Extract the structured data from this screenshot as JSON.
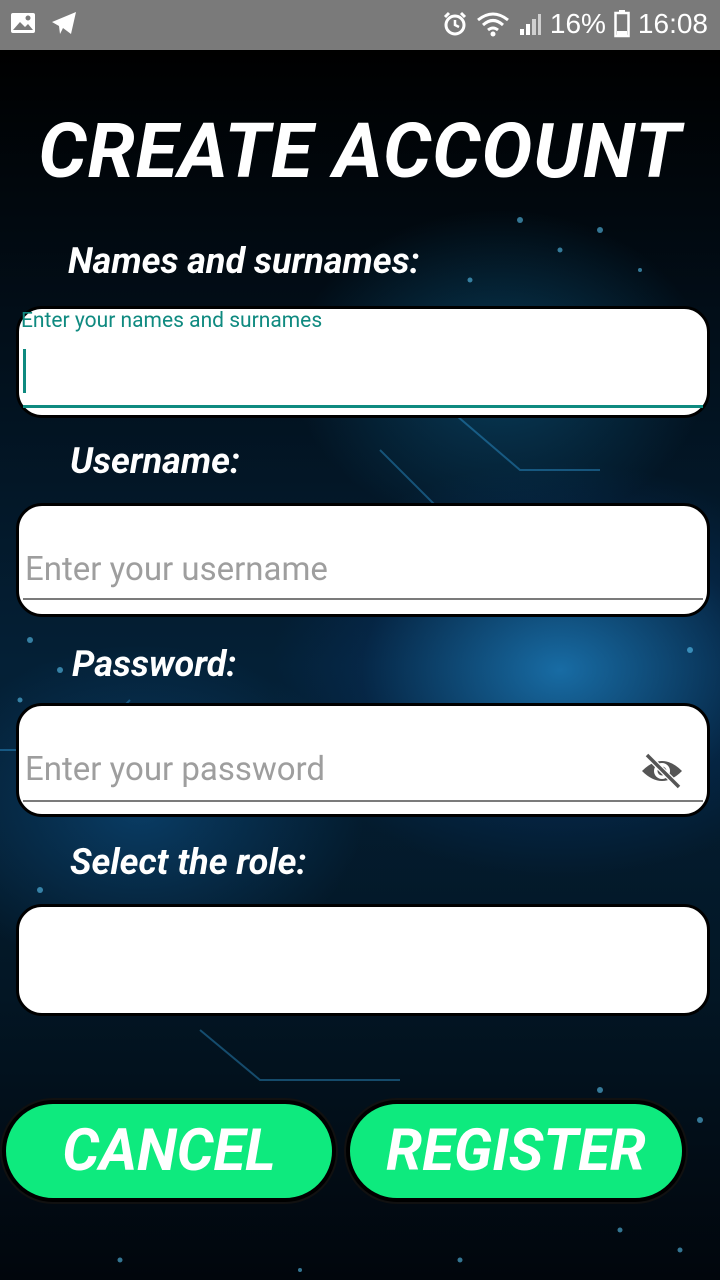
{
  "status_bar": {
    "battery_percent": "16%",
    "time": "16:08",
    "left_icons": [
      "gallery-icon",
      "telegram-icon"
    ],
    "right_icons": [
      "alarm-icon",
      "wifi-icon",
      "signal-icon",
      "battery-icon"
    ]
  },
  "page": {
    "title": "CREATE ACCOUNT"
  },
  "form": {
    "names": {
      "label": "Names and surnames:",
      "floating_hint": "Enter your names and surnames",
      "value": ""
    },
    "username": {
      "label": "Username:",
      "placeholder": "Enter your username"
    },
    "password": {
      "label": "Password:",
      "placeholder": "Enter your password",
      "toggle_icon": "eye-off-icon"
    },
    "role": {
      "label": "Select the role:",
      "value": ""
    }
  },
  "buttons": {
    "cancel": "CANCEL",
    "register": "REGISTER"
  },
  "colors": {
    "accent_green": "#0eea7e",
    "focus_teal": "#0f8a80"
  }
}
